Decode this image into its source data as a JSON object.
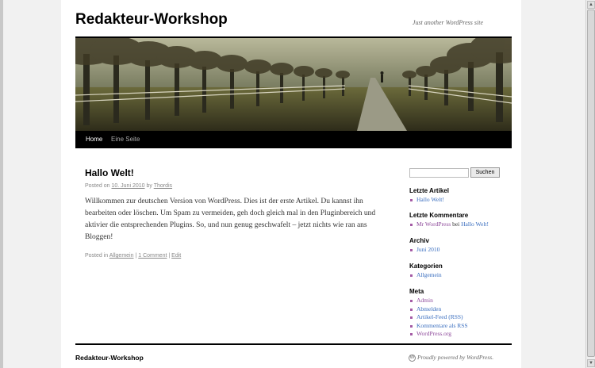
{
  "site": {
    "title": "Redakteur-Workshop",
    "description": "Just another WordPress site"
  },
  "nav": {
    "items": [
      "Home",
      "Eine Seite"
    ]
  },
  "post": {
    "title": "Hallo Welt!",
    "meta_prefix": "Posted on",
    "date": "10. Juni 2010",
    "meta_by": "by",
    "author": "Thordis",
    "content": "Willkommen zur deutschen Version von WordPress. Dies ist der erste Artikel. Du kannst ihn bearbeiten oder löschen. Um Spam zu vermeiden, geh doch gleich mal in den Pluginbereich und aktivier die entsprechenden Plugins. So, und nun genug geschwafelt – jetzt nichts wie ran ans Bloggen!",
    "util_prefix": "Posted in",
    "category": "Allgemein",
    "separator": "|",
    "comments": "1 Comment",
    "edit": "Edit"
  },
  "sidebar": {
    "search_button": "Suchen",
    "search_value": "",
    "recent_posts_title": "Letzte Artikel",
    "recent_posts": [
      "Hallo Welt!"
    ],
    "recent_comments_title": "Letzte Kommentare",
    "recent_comment": {
      "author": "Mr WordPress",
      "joiner": "bei",
      "post": "Hallo Welt!"
    },
    "archives_title": "Archiv",
    "archives": [
      "Juni 2010"
    ],
    "categories_title": "Kategorien",
    "categories": [
      "Allgemein"
    ],
    "meta_title": "Meta",
    "meta_links": [
      "Admin",
      "Abmelden",
      "Artikel-Feed (RSS)",
      "Kommentare als RSS",
      "WordPress.org"
    ]
  },
  "footer": {
    "title": "Redakteur-Workshop",
    "powered": "Proudly powered by WordPress."
  },
  "colors": {
    "link": "#3a6ebf",
    "visited": "#8e4a9b",
    "nav_bg": "#000000",
    "bullet": "#a45ba5"
  },
  "icons": [
    "wordpress-icon",
    "scroll-up-icon",
    "scroll-down-icon"
  ]
}
